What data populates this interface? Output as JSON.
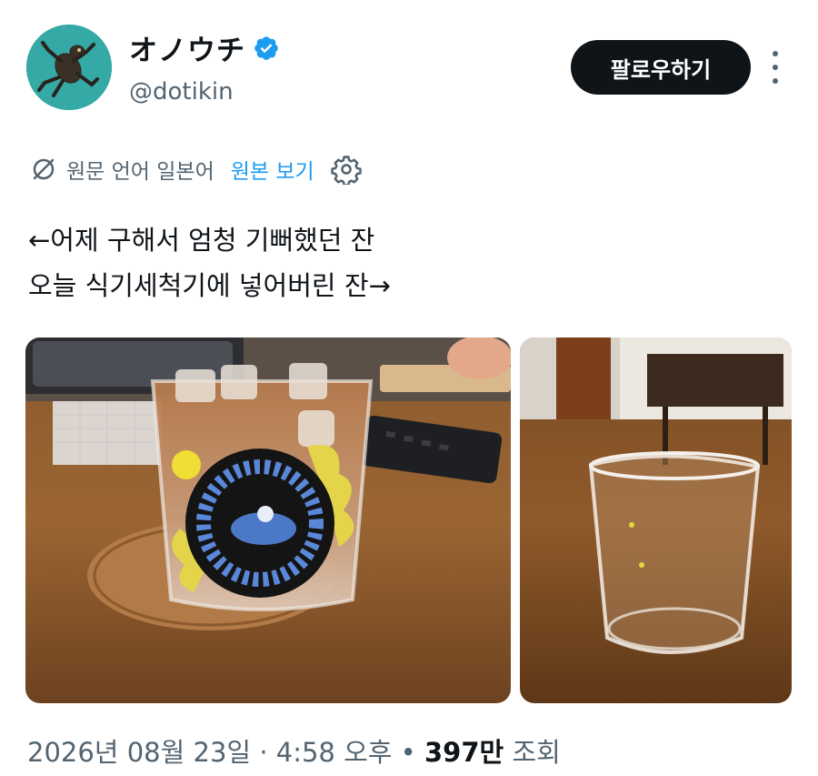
{
  "author": {
    "display_name": "オノウチ",
    "handle": "@dotikin",
    "avatar_icon": "frog-avatar",
    "verified_icon": "verified-badge-icon"
  },
  "actions": {
    "follow_label": "팔로우하기",
    "more_icon": "more-vertical-icon"
  },
  "translation": {
    "icon": "translate-icon",
    "source_language_text": "원문 언어 일본어",
    "view_original_label": "원본 보기",
    "settings_icon": "gear-icon"
  },
  "tweet": {
    "lines": [
      "←어제 구해서 엄청 기뻐했던 잔",
      "오늘 식기세척기에 넣어버린 잔→"
    ]
  },
  "media": [
    {
      "name": "photo-glass-with-iced-coffee"
    },
    {
      "name": "photo-empty-glass"
    }
  ],
  "meta": {
    "date": "2026년 08월 23일",
    "separator": "·",
    "time": "4:58 오후",
    "bullet": "•",
    "views_count": "397만",
    "views_label": "조회"
  },
  "colors": {
    "accent": "#1d9bf0",
    "secondary_text": "#536471",
    "button_bg": "#0f1419"
  }
}
